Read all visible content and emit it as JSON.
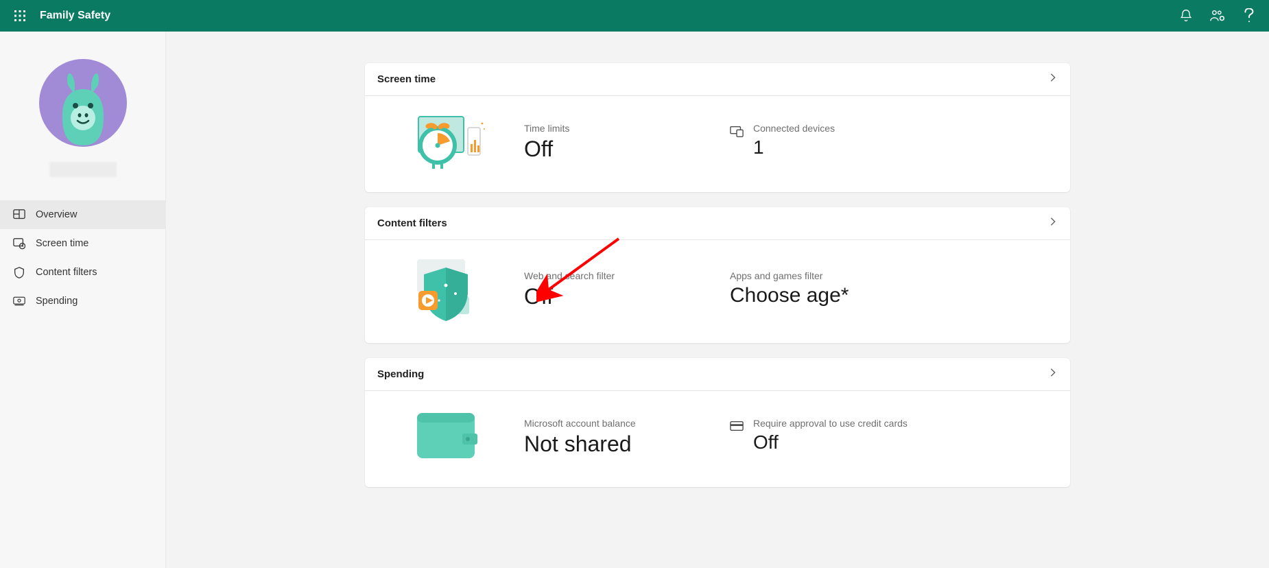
{
  "header": {
    "title": "Family Safety"
  },
  "sidebar": {
    "items": [
      {
        "id": "overview",
        "label": "Overview",
        "active": true
      },
      {
        "id": "screen_time",
        "label": "Screen time",
        "active": false
      },
      {
        "id": "content_filters",
        "label": "Content filters",
        "active": false
      },
      {
        "id": "spending",
        "label": "Spending",
        "active": false
      }
    ]
  },
  "cards": {
    "screen_time": {
      "title": "Screen time",
      "time_limits_label": "Time limits",
      "time_limits_value": "Off",
      "connected_devices_label": "Connected devices",
      "connected_devices_value": "1"
    },
    "content_filters": {
      "title": "Content filters",
      "web_filter_label": "Web and search filter",
      "web_filter_value": "Off",
      "apps_filter_label": "Apps and games filter",
      "apps_filter_value": "Choose age*"
    },
    "spending": {
      "title": "Spending",
      "balance_label": "Microsoft account balance",
      "balance_value": "Not shared",
      "approval_label": "Require approval to use credit cards",
      "approval_value": "Off"
    }
  }
}
